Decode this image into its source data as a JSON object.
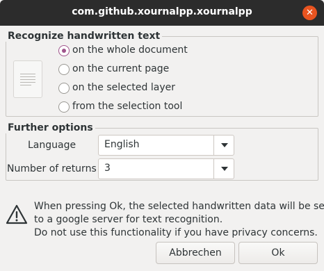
{
  "window": {
    "title": "com.github.xournalpp.xournalpp"
  },
  "recognize": {
    "legend": "Recognize handwritten text",
    "options": [
      {
        "label": "on the whole document",
        "selected": true
      },
      {
        "label": "on the current page",
        "selected": false
      },
      {
        "label": "on the selected layer",
        "selected": false
      },
      {
        "label": "from the selection tool",
        "selected": false
      }
    ]
  },
  "further": {
    "legend": "Further options",
    "language_label": "Language",
    "language_value": "English",
    "returns_label": "Number of returns",
    "returns_value": "3"
  },
  "warning": {
    "lines": [
      "When pressing Ok, the selected handwritten data will be sent",
      "to a google server for text recognition.",
      "Do not use this functionality if you have privacy concerns."
    ]
  },
  "buttons": {
    "cancel": "Abbrechen",
    "ok": "Ok"
  },
  "colors": {
    "accent": "#a0548c",
    "close": "#e95420",
    "titlebar": "#2c2c2c"
  }
}
